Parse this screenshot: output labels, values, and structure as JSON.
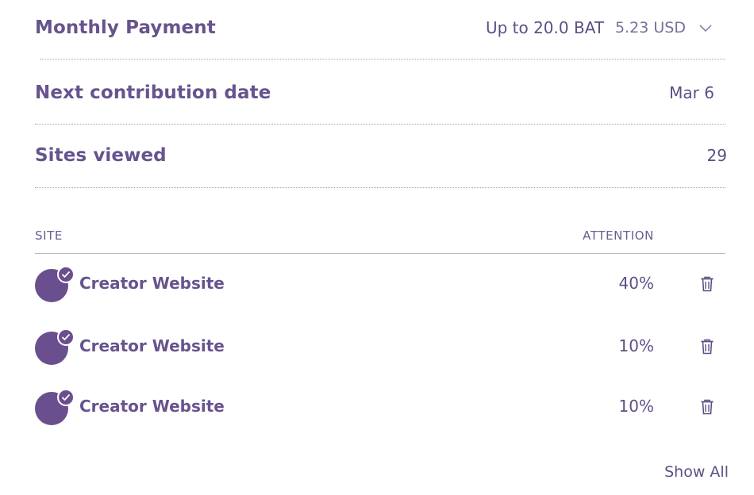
{
  "settings": {
    "monthly_payment": {
      "label": "Monthly Payment",
      "bat_amount": "Up to 20.0 BAT",
      "usd_amount": "5.23 USD"
    },
    "next_contribution": {
      "label": "Next contribution date",
      "value": "Mar 6"
    },
    "sites_viewed": {
      "label": "Sites viewed",
      "value": "29"
    }
  },
  "table": {
    "headers": {
      "site": "SITE",
      "attention": "ATTENTION"
    },
    "rows": [
      {
        "name": "Creator Website",
        "attention": "40%"
      },
      {
        "name": "Creator Website",
        "attention": "10%"
      },
      {
        "name": "Creator Website",
        "attention": "10%"
      }
    ]
  },
  "footer": {
    "show_all": "Show All"
  },
  "icons": {
    "dropdown": "chevron-down-icon",
    "verified": "check-icon",
    "delete": "trash-icon"
  },
  "colors": {
    "brand_purple": "#6a4f8e",
    "text_purple": "#67538d"
  }
}
